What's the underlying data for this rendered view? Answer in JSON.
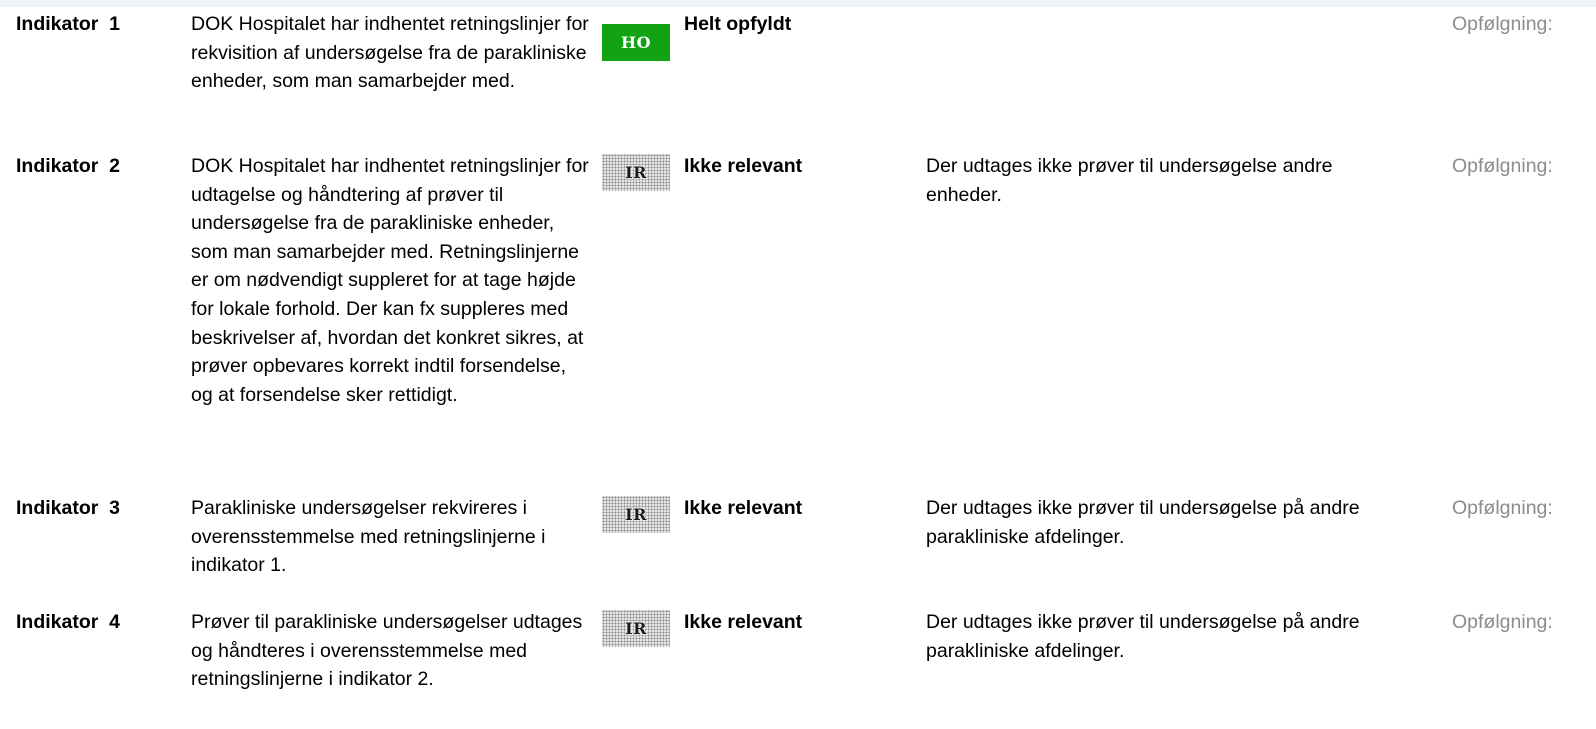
{
  "indicators": [
    {
      "label": "Indikator  1",
      "text": "DOK Hospitalet har indhentet retningslinjer for rekvisition af undersøgelse fra de parakliniske enheder, som man samarbejder med.",
      "badge": "HO",
      "status": "Helt opfyldt",
      "comment": "",
      "followup": "Opfølgning:"
    },
    {
      "label": "Indikator  2",
      "text": "DOK Hospitalet har indhentet retningslinjer for udtagelse og håndtering af prøver til undersøgelse fra de parakliniske enheder, som man samarbejder med. Retningslinjerne er om nødvendigt suppleret for at tage højde for lokale forhold.   Der kan fx suppleres med beskrivelser af, hvordan det konkret sikres, at prøver opbevares korrekt indtil forsendelse, og at forsendelse sker rettidigt.",
      "badge": "IR",
      "status": "Ikke relevant",
      "comment": "Der udtages ikke prøver til undersøgelse andre enheder.",
      "followup": "Opfølgning:"
    },
    {
      "label": "Indikator  3",
      "text": "Parakliniske undersøgelser rekvireres i overensstemmelse med retningslinjerne i indikator 1.",
      "badge": "IR",
      "status": "Ikke relevant",
      "comment": "Der udtages ikke prøver til undersøgelse på andre parakliniske afdelinger.",
      "followup": "Opfølgning:"
    },
    {
      "label": "Indikator  4",
      "text": "Prøver til parakliniske undersøgelser udtages og håndteres i overensstemmelse med retningslinjerne i indikator 2.",
      "badge": "IR",
      "status": "Ikke relevant",
      "comment": "Der udtages ikke prøver til undersøgelse på andre parakliniske afdelinger.",
      "followup": "Opfølgning:"
    }
  ],
  "colors": {
    "ho_badge": "#12a312",
    "followup_text": "#8c8c8c"
  }
}
